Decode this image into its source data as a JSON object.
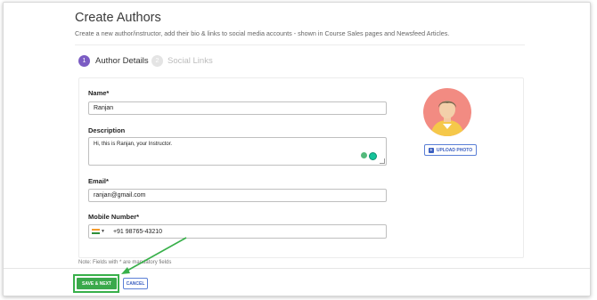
{
  "header": {
    "title": "Create Authors",
    "subtitle": "Create a new author/instructor, add their bio & links to social media accounts - shown in Course Sales pages and Newsfeed Articles."
  },
  "steps": [
    {
      "number": "1",
      "label": "Author Details",
      "active": true
    },
    {
      "number": "2",
      "label": "Social Links",
      "active": false
    }
  ],
  "form": {
    "name_label": "Name*",
    "name_value": "Ranjan",
    "description_label": "Description",
    "description_value": "Hi, this is Ranjan, your Instructor.",
    "email_label": "Email*",
    "email_value": "ranjan@gmail.com",
    "mobile_label": "Mobile Number*",
    "mobile_value": "+91 98765-43210",
    "note": "Note: Fields with * are mandatory fields"
  },
  "photo": {
    "upload_label": "UPLOAD PHOTO"
  },
  "actions": {
    "save_label": "SAVE & NEXT",
    "cancel_label": "CANCEL"
  },
  "colors": {
    "accent": "#7b5cc3",
    "save_green": "#3aa94b",
    "highlight_green": "#38b04a",
    "link_blue": "#3b5fc0",
    "avatar_bg": "#f28b82"
  },
  "icons": {
    "flag": "india-flag-icon",
    "upload": "plus-square-icon",
    "grammar": "grammarly-icon"
  }
}
